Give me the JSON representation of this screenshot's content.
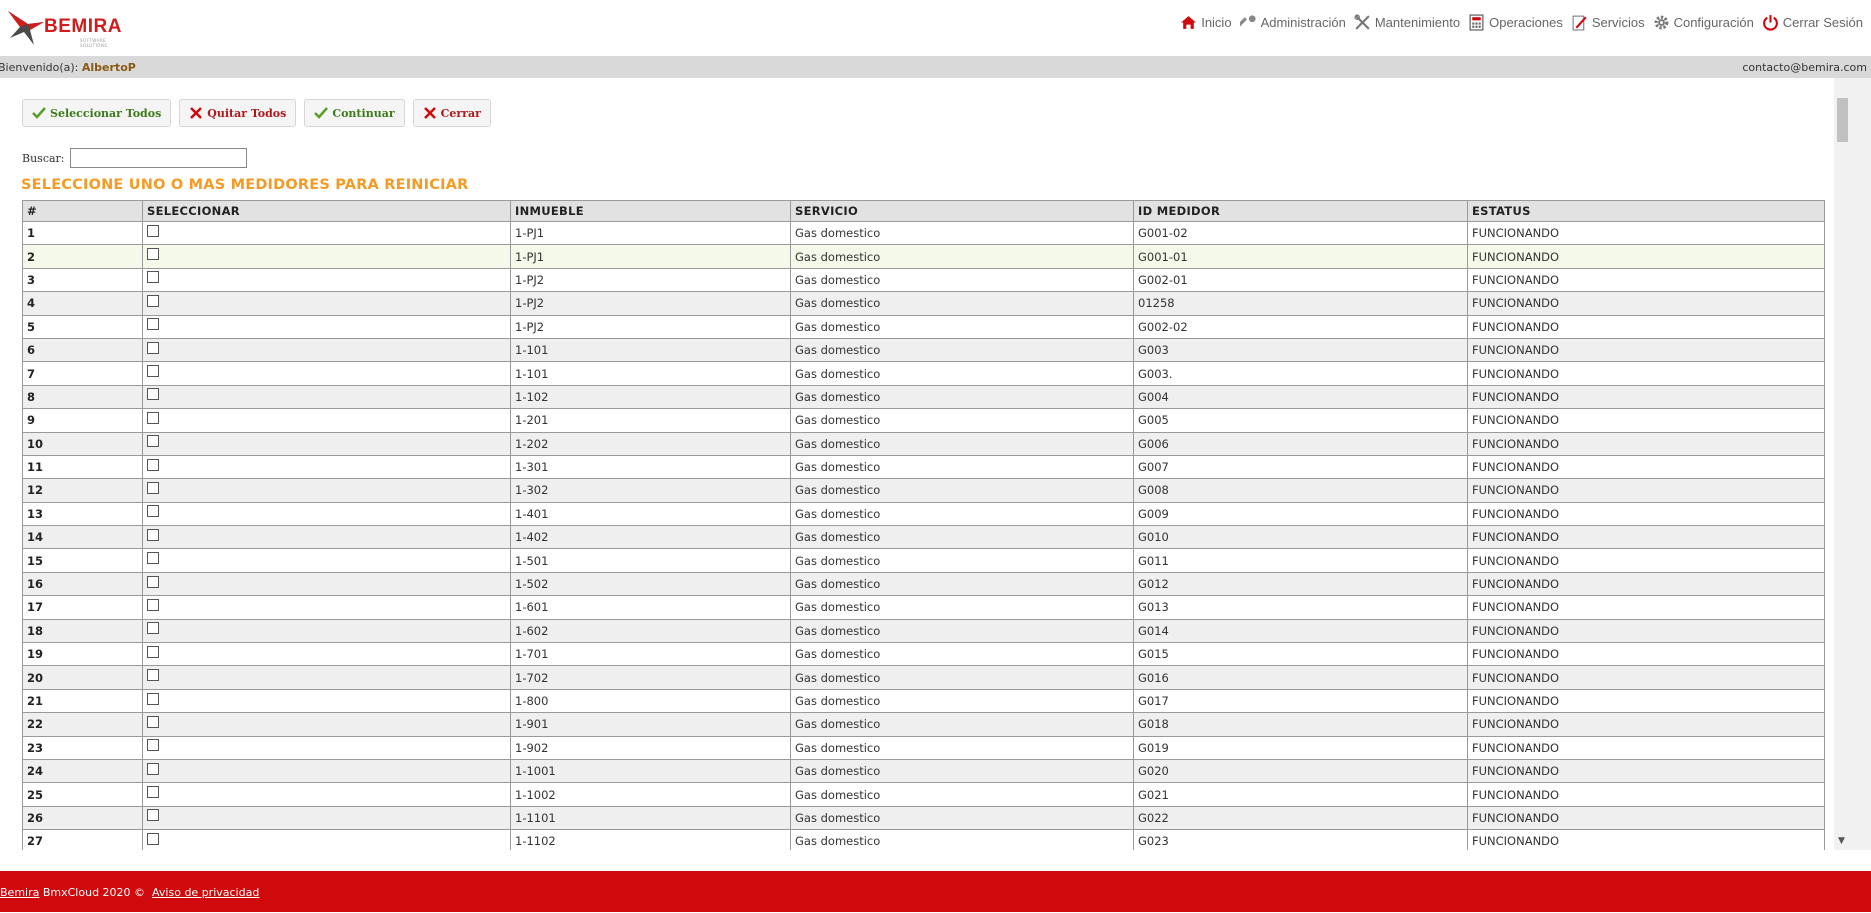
{
  "header": {
    "logo_text": "BEMIRA",
    "logo_subtitle": "SOFTWARE SOLUTIONS",
    "nav": [
      {
        "label": "Inicio",
        "icon": "home-icon"
      },
      {
        "label": "Administración",
        "icon": "key-icon"
      },
      {
        "label": "Mantenimiento",
        "icon": "tools-icon"
      },
      {
        "label": "Operaciones",
        "icon": "calculator-icon"
      },
      {
        "label": "Servicios",
        "icon": "document-edit-icon"
      },
      {
        "label": "Configuración",
        "icon": "gear-icon"
      },
      {
        "label": "Cerrar Sesión",
        "icon": "power-icon"
      }
    ]
  },
  "welcome": {
    "prefix": "Bienvenido(a):",
    "user": "AlbertoP",
    "contact": "contacto@bemira.com"
  },
  "toolbar": {
    "select_all": "Seleccionar Todos",
    "remove_all": "Quitar Todos",
    "continue": "Continuar",
    "close": "Cerrar"
  },
  "search": {
    "label": "Buscar:",
    "value": ""
  },
  "section_title": "SELECCIONE UNO O MAS MEDIDORES PARA REINICIAR",
  "table": {
    "columns": [
      "#",
      "SELECCIONAR",
      "INMUEBLE",
      "SERVICIO",
      "ID MEDIDOR",
      "ESTATUS"
    ],
    "rows": [
      {
        "n": "1",
        "inmueble": "1-PJ1",
        "servicio": "Gas domestico",
        "medidor": "G001-02",
        "estatus": "FUNCIONANDO",
        "checked": false
      },
      {
        "n": "2",
        "inmueble": "1-PJ1",
        "servicio": "Gas domestico",
        "medidor": "G001-01",
        "estatus": "FUNCIONANDO",
        "checked": false
      },
      {
        "n": "3",
        "inmueble": "1-PJ2",
        "servicio": "Gas domestico",
        "medidor": "G002-01",
        "estatus": "FUNCIONANDO",
        "checked": false
      },
      {
        "n": "4",
        "inmueble": "1-PJ2",
        "servicio": "Gas domestico",
        "medidor": "01258",
        "estatus": "FUNCIONANDO",
        "checked": false
      },
      {
        "n": "5",
        "inmueble": "1-PJ2",
        "servicio": "Gas domestico",
        "medidor": "G002-02",
        "estatus": "FUNCIONANDO",
        "checked": false
      },
      {
        "n": "6",
        "inmueble": "1-101",
        "servicio": "Gas domestico",
        "medidor": "G003",
        "estatus": "FUNCIONANDO",
        "checked": false
      },
      {
        "n": "7",
        "inmueble": "1-101",
        "servicio": "Gas domestico",
        "medidor": "G003.",
        "estatus": "FUNCIONANDO",
        "checked": false
      },
      {
        "n": "8",
        "inmueble": "1-102",
        "servicio": "Gas domestico",
        "medidor": "G004",
        "estatus": "FUNCIONANDO",
        "checked": false
      },
      {
        "n": "9",
        "inmueble": "1-201",
        "servicio": "Gas domestico",
        "medidor": "G005",
        "estatus": "FUNCIONANDO",
        "checked": false
      },
      {
        "n": "10",
        "inmueble": "1-202",
        "servicio": "Gas domestico",
        "medidor": "G006",
        "estatus": "FUNCIONANDO",
        "checked": false
      },
      {
        "n": "11",
        "inmueble": "1-301",
        "servicio": "Gas domestico",
        "medidor": "G007",
        "estatus": "FUNCIONANDO",
        "checked": false
      },
      {
        "n": "12",
        "inmueble": "1-302",
        "servicio": "Gas domestico",
        "medidor": "G008",
        "estatus": "FUNCIONANDO",
        "checked": false
      },
      {
        "n": "13",
        "inmueble": "1-401",
        "servicio": "Gas domestico",
        "medidor": "G009",
        "estatus": "FUNCIONANDO",
        "checked": false
      },
      {
        "n": "14",
        "inmueble": "1-402",
        "servicio": "Gas domestico",
        "medidor": "G010",
        "estatus": "FUNCIONANDO",
        "checked": false
      },
      {
        "n": "15",
        "inmueble": "1-501",
        "servicio": "Gas domestico",
        "medidor": "G011",
        "estatus": "FUNCIONANDO",
        "checked": false
      },
      {
        "n": "16",
        "inmueble": "1-502",
        "servicio": "Gas domestico",
        "medidor": "G012",
        "estatus": "FUNCIONANDO",
        "checked": false
      },
      {
        "n": "17",
        "inmueble": "1-601",
        "servicio": "Gas domestico",
        "medidor": "G013",
        "estatus": "FUNCIONANDO",
        "checked": false
      },
      {
        "n": "18",
        "inmueble": "1-602",
        "servicio": "Gas domestico",
        "medidor": "G014",
        "estatus": "FUNCIONANDO",
        "checked": false
      },
      {
        "n": "19",
        "inmueble": "1-701",
        "servicio": "Gas domestico",
        "medidor": "G015",
        "estatus": "FUNCIONANDO",
        "checked": false
      },
      {
        "n": "20",
        "inmueble": "1-702",
        "servicio": "Gas domestico",
        "medidor": "G016",
        "estatus": "FUNCIONANDO",
        "checked": false
      },
      {
        "n": "21",
        "inmueble": "1-800",
        "servicio": "Gas domestico",
        "medidor": "G017",
        "estatus": "FUNCIONANDO",
        "checked": false
      },
      {
        "n": "22",
        "inmueble": "1-901",
        "servicio": "Gas domestico",
        "medidor": "G018",
        "estatus": "FUNCIONANDO",
        "checked": false
      },
      {
        "n": "23",
        "inmueble": "1-902",
        "servicio": "Gas domestico",
        "medidor": "G019",
        "estatus": "FUNCIONANDO",
        "checked": false
      },
      {
        "n": "24",
        "inmueble": "1-1001",
        "servicio": "Gas domestico",
        "medidor": "G020",
        "estatus": "FUNCIONANDO",
        "checked": false
      },
      {
        "n": "25",
        "inmueble": "1-1002",
        "servicio": "Gas domestico",
        "medidor": "G021",
        "estatus": "FUNCIONANDO",
        "checked": false
      },
      {
        "n": "26",
        "inmueble": "1-1101",
        "servicio": "Gas domestico",
        "medidor": "G022",
        "estatus": "FUNCIONANDO",
        "checked": false
      },
      {
        "n": "27",
        "inmueble": "1-1102",
        "servicio": "Gas domestico",
        "medidor": "G023",
        "estatus": "FUNCIONANDO",
        "checked": false
      }
    ]
  },
  "footer": {
    "brand_link": "Bemira",
    "text": "BmxCloud 2020 ©",
    "privacy_link": "Aviso de privacidad"
  },
  "colors": {
    "brand_red": "#d0090d",
    "title_orange": "#f39b24",
    "user_brown": "#8a5a12",
    "ok_green": "#3c7a1a",
    "cancel_red": "#b3161a"
  }
}
